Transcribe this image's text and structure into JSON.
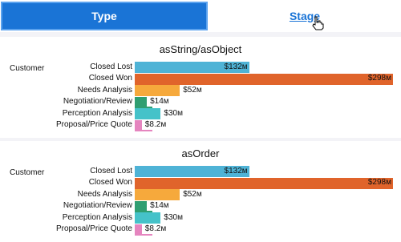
{
  "tabs": {
    "type_label": "Type",
    "stage_label": "Stage"
  },
  "chart_data": [
    {
      "type": "bar",
      "orientation": "horizontal",
      "title": "asString/asObject",
      "dimension_label": "Customer",
      "categories": [
        "Closed Lost",
        "Closed Won",
        "Needs Analysis",
        "Negotiation/Review",
        "Perception Analysis",
        "Proposal/Price Quote"
      ],
      "values": [
        132,
        298,
        52,
        14,
        30,
        8.2
      ],
      "value_labels": [
        "$132м",
        "$298м",
        "$52м",
        "$14м",
        "$30м",
        "$8.2м"
      ],
      "colors": [
        "#4fb3d6",
        "#e0642b",
        "#f6a93c",
        "#2f9e71",
        "#45c2c9",
        "#e585bf"
      ]
    },
    {
      "type": "bar",
      "orientation": "horizontal",
      "title": "asOrder",
      "dimension_label": "Customer",
      "categories": [
        "Closed Lost",
        "Closed Won",
        "Needs Analysis",
        "Negotiation/Review",
        "Perception Analysis",
        "Proposal/Price Quote"
      ],
      "values": [
        132,
        298,
        52,
        14,
        30,
        8.2
      ],
      "value_labels": [
        "$132м",
        "$298м",
        "$52м",
        "$14м",
        "$30м",
        "$8.2м"
      ],
      "colors": [
        "#4fb3d6",
        "#e0642b",
        "#f6a93c",
        "#2f9e71",
        "#45c2c9",
        "#e585bf"
      ]
    }
  ]
}
